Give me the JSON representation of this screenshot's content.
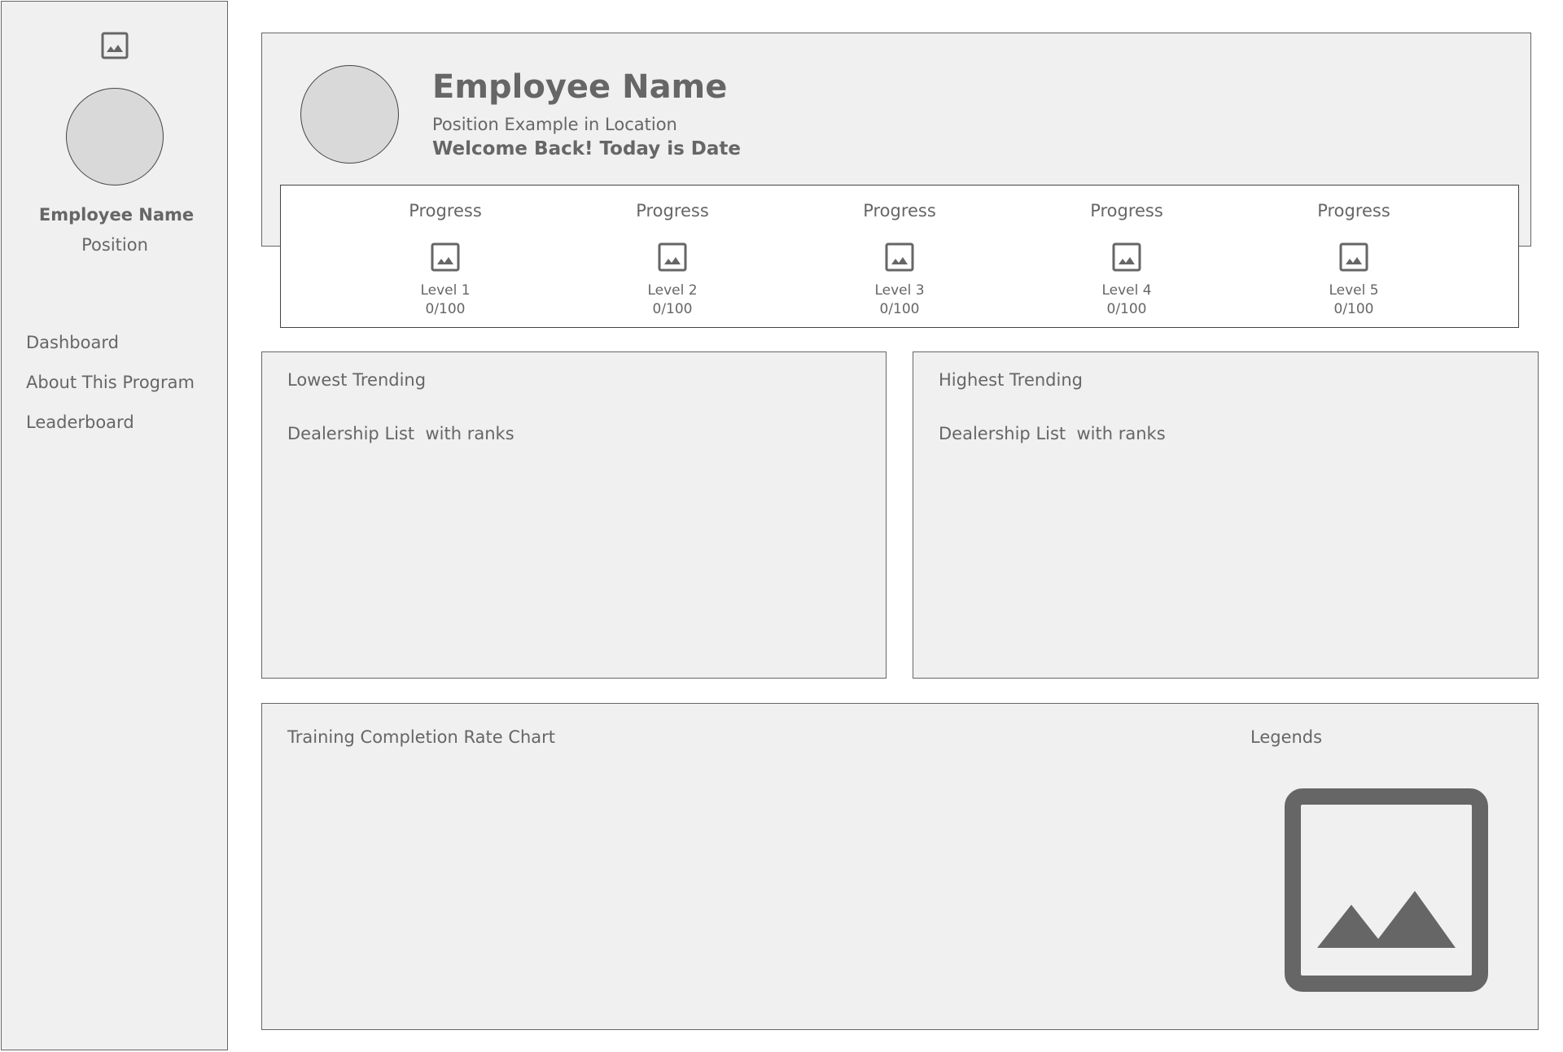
{
  "sidebar": {
    "logo_icon": "image-icon",
    "employee_name": "Employee Name",
    "position": "Position",
    "nav": [
      {
        "label": "Dashboard"
      },
      {
        "label": "About This Program"
      },
      {
        "label": "Leaderboard"
      }
    ]
  },
  "header": {
    "employee_name": "Employee Name",
    "position_line": "Position Example in Location",
    "welcome": "Welcome Back! Today is Date"
  },
  "progress": [
    {
      "title": "Progress",
      "icon": "image-icon",
      "level": "Level 1",
      "score": "0/100"
    },
    {
      "title": "Progress",
      "icon": "image-icon",
      "level": "Level 2",
      "score": "0/100"
    },
    {
      "title": "Progress",
      "icon": "image-icon",
      "level": "Level 3",
      "score": "0/100"
    },
    {
      "title": "Progress",
      "icon": "image-icon",
      "level": "Level 4",
      "score": "0/100"
    },
    {
      "title": "Progress",
      "icon": "image-icon",
      "level": "Level 5",
      "score": "0/100"
    }
  ],
  "lowest_trending": {
    "title": "Lowest Trending",
    "subtitle": "Dealership List  with ranks"
  },
  "highest_trending": {
    "title": "Highest Trending",
    "subtitle": "Dealership List  with ranks"
  },
  "chart": {
    "title": "Training Completion Rate Chart",
    "legends_label": "Legends",
    "legend_icon": "image-icon"
  },
  "colors": {
    "panel_bg": "#f0f0f0",
    "border": "#666666",
    "text": "#666666",
    "avatar": "#d9d9d9"
  }
}
